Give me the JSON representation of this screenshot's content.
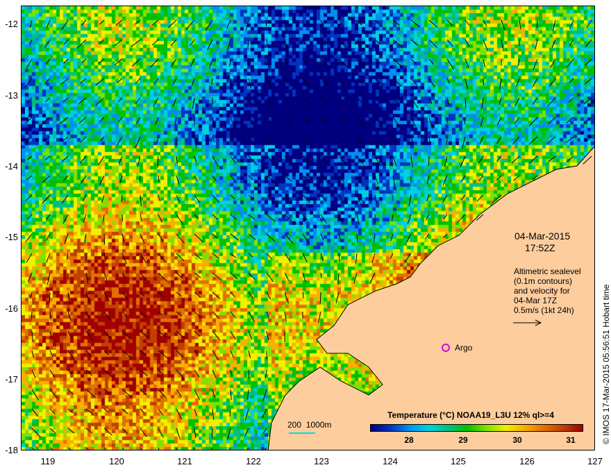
{
  "map": {
    "x_ticks": [
      "119",
      "120",
      "121",
      "122",
      "123",
      "124",
      "125",
      "126",
      "127"
    ],
    "y_ticks": [
      "-12",
      "-13",
      "-14",
      "-15",
      "-16",
      "-17",
      "-18"
    ],
    "date": "04-Mar-2015",
    "time": "17:52Z",
    "legend_lines": [
      "Altimetric sealevel",
      "(0.1m contours)",
      "and velocity for",
      "04-Mar 17Z",
      "0.5m/s (1kt 24h)"
    ],
    "argo_label": "Argo",
    "scale_label": "200  1000m",
    "colors": {
      "land": "#fdcd9d",
      "argo": "#e000e0",
      "bathy": "#00e0e0"
    }
  },
  "colorbar": {
    "title": "Temperature (°C) NOAA19_L3U 12% ql>=4",
    "ticks": [
      "28",
      "29",
      "30",
      "31"
    ],
    "range": [
      27.45,
      31.25
    ]
  },
  "footer": {
    "copyright": "© IMOS 17-Mar-2015 05:56:51 Hobart time"
  }
}
